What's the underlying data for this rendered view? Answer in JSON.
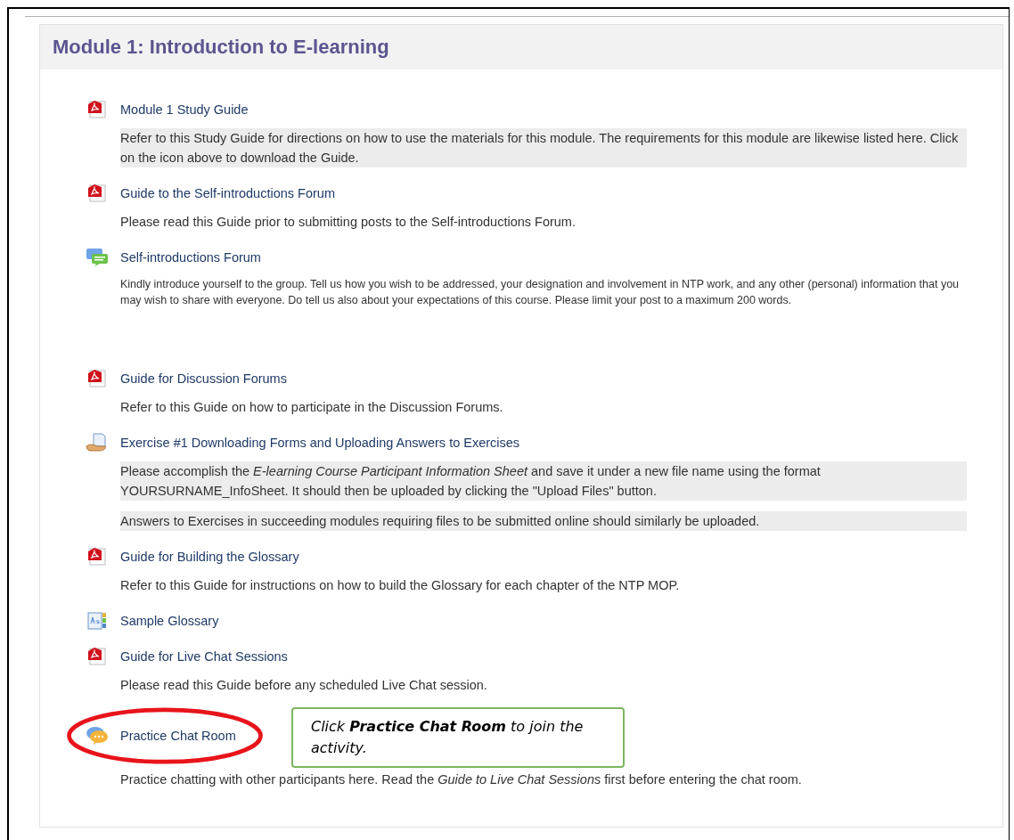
{
  "section": {
    "title": "Module 1: Introduction to E-learning"
  },
  "items": [
    {
      "kind": "pdf",
      "title": "Module 1 Study Guide",
      "circled": false,
      "paragraphs": [
        {
          "text": "Refer to this Study Guide for directions on how to use the materials for this module. The requirements for this module are likewise listed here. Click on the icon above to download the Guide.",
          "highlight": true,
          "small": false
        }
      ]
    },
    {
      "kind": "pdf",
      "title": "Guide to the Self-introductions Forum",
      "circled": false,
      "paragraphs": [
        {
          "text": "Please read this Guide prior to submitting posts to the Self-introductions Forum.",
          "highlight": false,
          "small": false
        }
      ]
    },
    {
      "kind": "forum",
      "title": "Self-introductions Forum",
      "circled": false,
      "paragraphs": [
        {
          "text": "Kindly introduce yourself to the group. Tell us how you wish to be addressed, your designation and involvement in NTP work, and any other (personal) information that you may wish to share with everyone. Do tell us also about your expectations of this course. Please limit your post to a maximum 200 words.",
          "highlight": false,
          "small": true
        }
      ]
    },
    {
      "kind": "pdf",
      "title": "Guide for Discussion Forums",
      "circled": false,
      "paragraphs": [
        {
          "text": "Refer to this Guide on how to participate in the Discussion Forums.",
          "highlight": false,
          "small": false
        }
      ]
    },
    {
      "kind": "assignment",
      "title": "Exercise #1 Downloading Forms and Uploading Answers to Exercises",
      "circled": false,
      "paragraphs": [
        {
          "text": "Please accomplish the *E-learning Course Participant Information Sheet* and save it under a new file name using the format YOURSURNAME_InfoSheet. It should then be uploaded by clicking the \"Upload Files\" button.",
          "highlight": true,
          "small": false
        },
        {
          "text": "Answers to Exercises in succeeding modules requiring files to be submitted online should similarly be uploaded.",
          "highlight": true,
          "small": false
        }
      ]
    },
    {
      "kind": "pdf",
      "title": "Guide for Building the Glossary",
      "circled": false,
      "paragraphs": [
        {
          "text": "Refer to this Guide for instructions on how to build the Glossary for each chapter of the NTP MOP.",
          "highlight": false,
          "small": false
        }
      ]
    },
    {
      "kind": "glossary",
      "title": "Sample Glossary",
      "circled": false
    },
    {
      "kind": "pdf",
      "title": "Guide for Live Chat Sessions",
      "circled": false,
      "paragraphs": [
        {
          "text": "Please read this Guide before any scheduled Live Chat session.",
          "highlight": false,
          "small": false
        }
      ]
    },
    {
      "kind": "chat",
      "title": "Practice Chat Room",
      "circled": true,
      "callout": "Click **Practice Chat Room** to join the activity.",
      "paragraphs": [
        {
          "text": "Practice chatting with other participants here. Read the *Guide to Live Chat Sessions* first before entering the chat room.",
          "highlight": false,
          "small": false
        }
      ]
    }
  ]
}
